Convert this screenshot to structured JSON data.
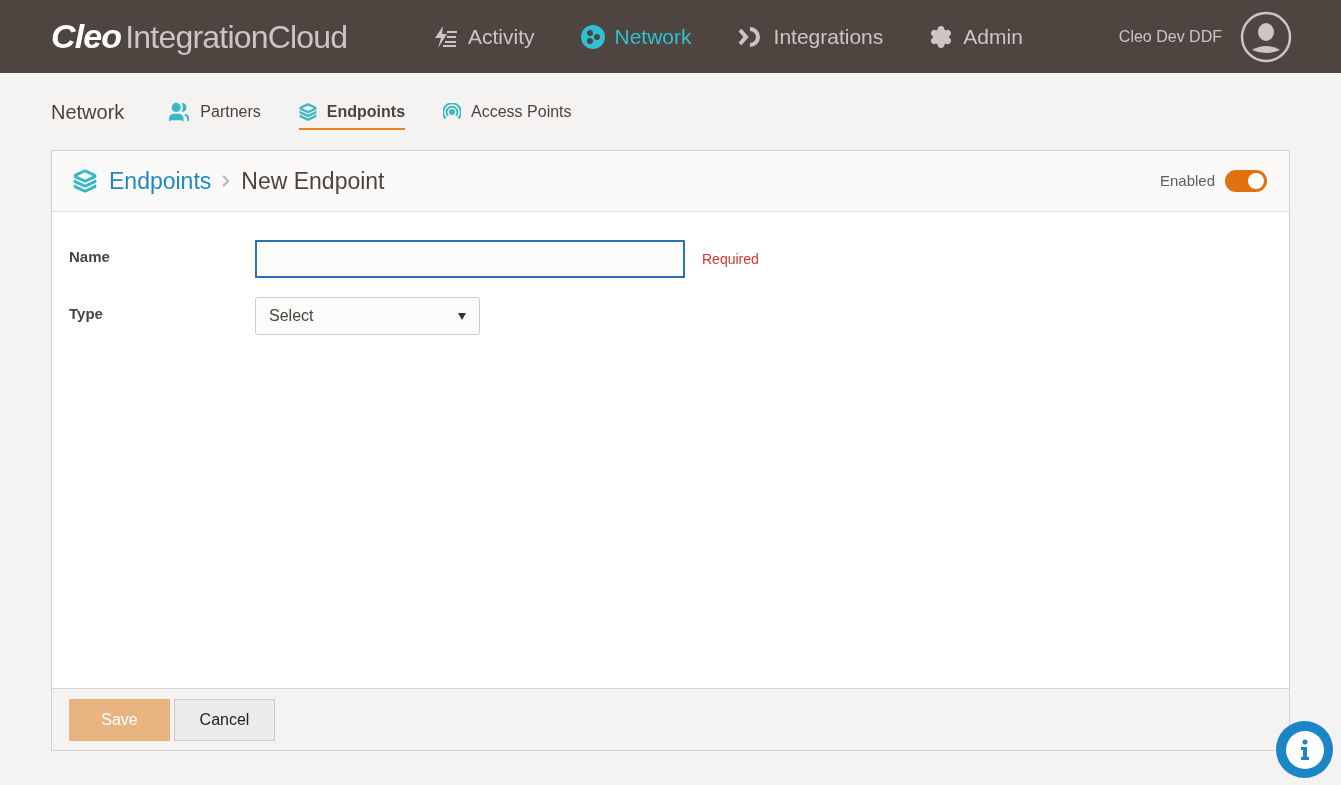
{
  "header": {
    "logo_bold": "Cleo",
    "logo_rest": "IntegrationCloud",
    "nav": [
      {
        "kind": "activity",
        "label": "Activity",
        "selected": false
      },
      {
        "kind": "network",
        "label": "Network",
        "selected": true
      },
      {
        "kind": "integrations",
        "label": "Integrations",
        "selected": false
      },
      {
        "kind": "admin",
        "label": "Admin",
        "selected": false
      }
    ],
    "user": "Cleo Dev DDF"
  },
  "subnav": {
    "title": "Network",
    "tabs": [
      {
        "kind": "partners",
        "label": "Partners",
        "selected": false
      },
      {
        "kind": "endpoints",
        "label": "Endpoints",
        "selected": true
      },
      {
        "kind": "access",
        "label": "Access Points",
        "selected": false
      }
    ]
  },
  "panel": {
    "breadcrumb": [
      "Endpoints",
      "New Endpoint"
    ],
    "toggle": {
      "label": "Enabled",
      "on": true
    },
    "fields": [
      {
        "kind": "text",
        "label": "Name",
        "focused": true,
        "error": "Required"
      },
      {
        "kind": "select",
        "label": "Type",
        "value": "Select"
      }
    ],
    "buttons": [
      {
        "kind": "primary",
        "label": "Save",
        "disabled": true
      },
      {
        "kind": "secondary",
        "label": "Cancel",
        "disabled": false
      }
    ]
  }
}
